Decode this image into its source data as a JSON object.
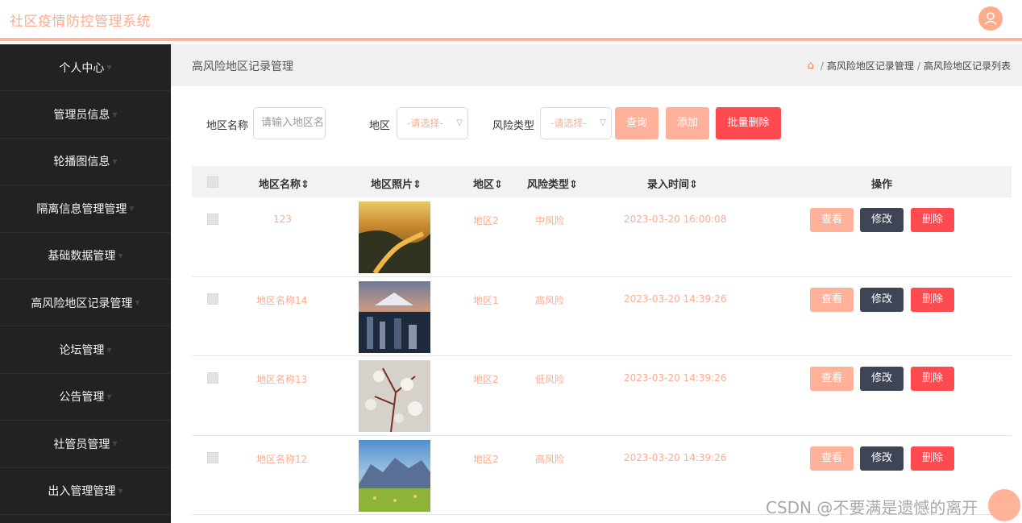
{
  "app": {
    "title": "社区疫情防控管理系统"
  },
  "sidebar": {
    "items": [
      {
        "label": "个人中心"
      },
      {
        "label": "管理员信息"
      },
      {
        "label": "轮播图信息"
      },
      {
        "label": "隔离信息管理管理"
      },
      {
        "label": "基础数据管理"
      },
      {
        "label": "高风险地区记录管理"
      },
      {
        "label": "论坛管理"
      },
      {
        "label": "公告管理"
      },
      {
        "label": "社管员管理"
      },
      {
        "label": "出入管理管理"
      }
    ]
  },
  "header": {
    "title": "高风险地区记录管理",
    "breadcrumb": [
      "高风险地区记录管理",
      "高风险地区记录列表"
    ]
  },
  "search": {
    "name_label": "地区名称",
    "name_placeholder": "请输入地区名称",
    "region_label": "地区",
    "region_value": "-请选择-",
    "risk_label": "风险类型",
    "risk_value": "-请选择-",
    "query_label": "查询",
    "add_label": "添加",
    "batch_delete_label": "批量删除"
  },
  "table": {
    "columns": [
      "地区名称",
      "地区照片",
      "地区",
      "风险类型",
      "录入时间",
      "操作"
    ],
    "rows": [
      {
        "name": "123",
        "region": "地区2",
        "risk": "中风险",
        "time": "2023-03-20 16:00:08"
      },
      {
        "name": "地区名称14",
        "region": "地区1",
        "risk": "高风险",
        "time": "2023-03-20 14:39:26"
      },
      {
        "name": "地区名称13",
        "region": "地区2",
        "risk": "低风险",
        "time": "2023-03-20 14:39:26"
      },
      {
        "name": "地区名称12",
        "region": "地区2",
        "risk": "高风险",
        "time": "2023-03-20 14:39:26"
      }
    ],
    "actions": {
      "view": "查看",
      "edit": "修改",
      "delete": "删除"
    }
  },
  "sort_icon": "⇕",
  "watermark": "CSDN @不要满是遗憾的离开",
  "colors": {
    "accent": "#ffab8e",
    "danger": "#ff4a4f",
    "dark_button": "#3f4555",
    "sidebar": "#222222"
  }
}
